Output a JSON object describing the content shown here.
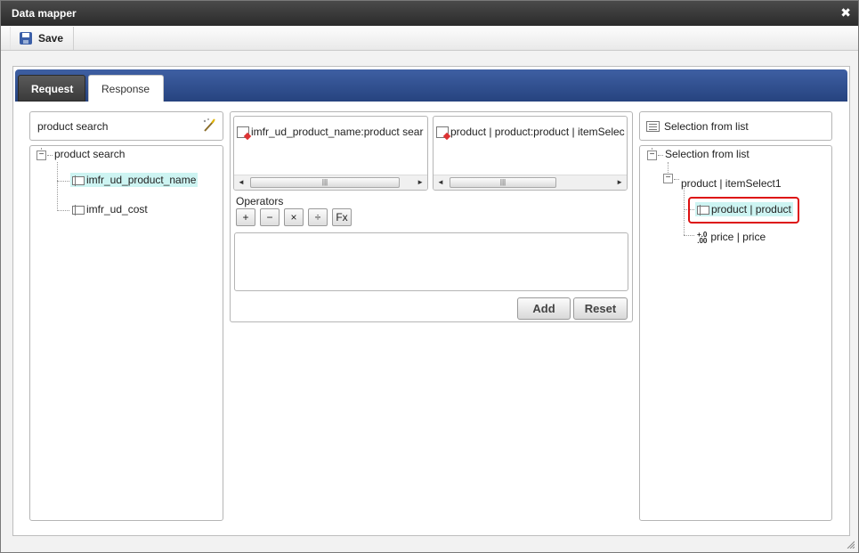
{
  "window": {
    "title": "Data mapper"
  },
  "toolbar": {
    "save_label": "Save"
  },
  "tabs": [
    {
      "label": "Request",
      "active": false
    },
    {
      "label": "Response",
      "active": true
    }
  ],
  "left": {
    "search_text": "product search",
    "tree_root": "product search",
    "fields": [
      {
        "label": "imfr_ud_product_name",
        "highlighted": true
      },
      {
        "label": "imfr_ud_cost",
        "highlighted": false
      }
    ]
  },
  "middle": {
    "list_left_item": "imfr_ud_product_name:product sear",
    "list_right_item": "product | product:product | itemSelec",
    "operators_label": "Operators",
    "operators": [
      "+",
      "−",
      "×",
      "÷",
      "Fx"
    ],
    "add_label": "Add",
    "reset_label": "Reset"
  },
  "right": {
    "header": "Selection from list",
    "tree_root": "Selection from list",
    "group": "product | itemSelect1",
    "items": [
      {
        "label": "product | product",
        "highlighted": true
      },
      {
        "label": "price | price",
        "highlighted": false
      }
    ]
  },
  "colors": {
    "tab_bar": "#2f4f91",
    "highlight": "#cdf4f2",
    "selection_frame": "#dd1111"
  }
}
